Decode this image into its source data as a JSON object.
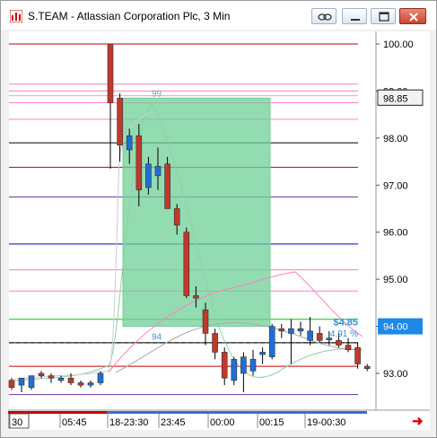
{
  "window": {
    "title": "S.TEAM - Atlassian Corporation Plc, 3 Min",
    "accent_close": "#c9452f"
  },
  "chart_data": {
    "type": "candlestick",
    "symbol": "S.TEAM",
    "interval": "3 Min",
    "price_axis": {
      "ticks": [
        "100.00",
        "99.00",
        "98.00",
        "97.00",
        "96.00",
        "95.00",
        "94.00",
        "93.00"
      ],
      "ylim": [
        92.5,
        100.2
      ]
    },
    "current_price_box": {
      "label": "98.85",
      "value": 98.85
    },
    "current_price_box_blue": {
      "label": "94.00",
      "value": 94.0,
      "color": "#1e88e5"
    },
    "time_axis": {
      "ticks": [
        "30",
        "05:45",
        "18-23:30",
        "23:45",
        "00:00",
        "00:15",
        "19-00:30"
      ]
    },
    "horizontal_lines": [
      {
        "price": 100.0,
        "color": "#c00000"
      },
      {
        "price": 99.15,
        "color": "#ff80c0"
      },
      {
        "price": 99.0,
        "color": "#ff80c0"
      },
      {
        "price": 98.9,
        "color": "#ff99cc"
      },
      {
        "price": 98.75,
        "color": "#ff80c0"
      },
      {
        "price": 98.4,
        "color": "#ff80c0"
      },
      {
        "price": 97.9,
        "color": "#000000"
      },
      {
        "price": 97.38,
        "color": "#c00000"
      },
      {
        "price": 96.75,
        "color": "#7030a0"
      },
      {
        "price": 95.75,
        "color": "#0000c0"
      },
      {
        "price": 95.2,
        "color": "#ff80c0"
      },
      {
        "price": 94.75,
        "color": "#ff80c0"
      },
      {
        "price": 94.15,
        "color": "#00cc00"
      },
      {
        "price": 93.65,
        "color": "#000000"
      },
      {
        "price": 93.15,
        "color": "#c00000"
      },
      {
        "price": 92.55,
        "color": "#7030a0"
      }
    ],
    "box": {
      "price_top": 98.85,
      "price_bottom": 94.0,
      "color": "#6fcf97"
    },
    "box_labels": {
      "top": "99",
      "bottom": "94"
    },
    "change_label": {
      "amount": "$4.85",
      "percent": "4.91 %"
    },
    "candles": [
      {
        "o": 92.85,
        "h": 92.9,
        "l": 92.65,
        "c": 92.7
      },
      {
        "o": 92.75,
        "h": 92.9,
        "l": 92.6,
        "c": 92.9
      },
      {
        "o": 92.7,
        "h": 92.95,
        "l": 92.65,
        "c": 92.95
      },
      {
        "o": 93.0,
        "h": 93.05,
        "l": 92.9,
        "c": 92.95
      },
      {
        "o": 92.95,
        "h": 93.0,
        "l": 92.8,
        "c": 92.9
      },
      {
        "o": 92.85,
        "h": 92.95,
        "l": 92.8,
        "c": 92.9
      },
      {
        "o": 92.9,
        "h": 93.0,
        "l": 92.75,
        "c": 92.8
      },
      {
        "o": 92.8,
        "h": 92.85,
        "l": 92.7,
        "c": 92.75
      },
      {
        "o": 92.75,
        "h": 92.85,
        "l": 92.7,
        "c": 92.8
      },
      {
        "o": 92.8,
        "h": 93.05,
        "l": 92.75,
        "c": 93.0
      },
      {
        "o": 100.0,
        "h": 100.0,
        "l": 97.35,
        "c": 98.75
      },
      {
        "o": 98.85,
        "h": 98.95,
        "l": 97.5,
        "c": 97.85
      },
      {
        "o": 97.75,
        "h": 98.2,
        "l": 97.45,
        "c": 98.05
      },
      {
        "o": 98.05,
        "h": 98.3,
        "l": 96.55,
        "c": 96.9
      },
      {
        "o": 96.95,
        "h": 97.6,
        "l": 96.8,
        "c": 97.45
      },
      {
        "o": 97.2,
        "h": 97.8,
        "l": 96.9,
        "c": 97.4
      },
      {
        "o": 97.45,
        "h": 97.6,
        "l": 96.5,
        "c": 96.5
      },
      {
        "o": 96.5,
        "h": 96.6,
        "l": 95.95,
        "c": 96.15
      },
      {
        "o": 96.0,
        "h": 96.1,
        "l": 94.6,
        "c": 94.65
      },
      {
        "o": 94.65,
        "h": 94.85,
        "l": 94.4,
        "c": 94.6
      },
      {
        "o": 94.35,
        "h": 94.5,
        "l": 93.6,
        "c": 93.85
      },
      {
        "o": 93.85,
        "h": 93.95,
        "l": 93.3,
        "c": 93.45
      },
      {
        "o": 93.45,
        "h": 93.55,
        "l": 92.75,
        "c": 92.9
      },
      {
        "o": 92.85,
        "h": 93.35,
        "l": 92.75,
        "c": 93.3
      },
      {
        "o": 93.0,
        "h": 93.45,
        "l": 92.6,
        "c": 93.35
      },
      {
        "o": 93.05,
        "h": 93.5,
        "l": 92.95,
        "c": 93.3
      },
      {
        "o": 93.4,
        "h": 93.55,
        "l": 93.2,
        "c": 93.45
      },
      {
        "o": 93.35,
        "h": 94.05,
        "l": 93.3,
        "c": 94.0
      },
      {
        "o": 93.95,
        "h": 94.05,
        "l": 93.75,
        "c": 93.9
      },
      {
        "o": 93.85,
        "h": 94.15,
        "l": 93.2,
        "c": 93.95
      },
      {
        "o": 93.9,
        "h": 94.1,
        "l": 93.8,
        "c": 93.95
      },
      {
        "o": 93.7,
        "h": 94.2,
        "l": 93.6,
        "c": 93.9
      },
      {
        "o": 93.85,
        "h": 94.0,
        "l": 93.65,
        "c": 93.7
      },
      {
        "o": 93.75,
        "h": 93.9,
        "l": 93.6,
        "c": 93.75
      },
      {
        "o": 93.7,
        "h": 93.85,
        "l": 93.55,
        "c": 93.6
      },
      {
        "o": 93.6,
        "h": 93.75,
        "l": 93.45,
        "c": 93.5
      },
      {
        "o": 93.55,
        "h": 93.65,
        "l": 93.1,
        "c": 93.2
      },
      {
        "o": 93.15,
        "h": 93.2,
        "l": 93.05,
        "c": 93.1
      }
    ],
    "colors": {
      "up": "#1e6fd9",
      "down": "#c0392b",
      "wick": "#000000"
    }
  },
  "icons": {
    "app": "app-icon",
    "link": "link-icon",
    "minimize": "minimize-icon",
    "maximize": "maximize-icon",
    "close": "close-icon",
    "scroll": "right-arrow-icon"
  }
}
